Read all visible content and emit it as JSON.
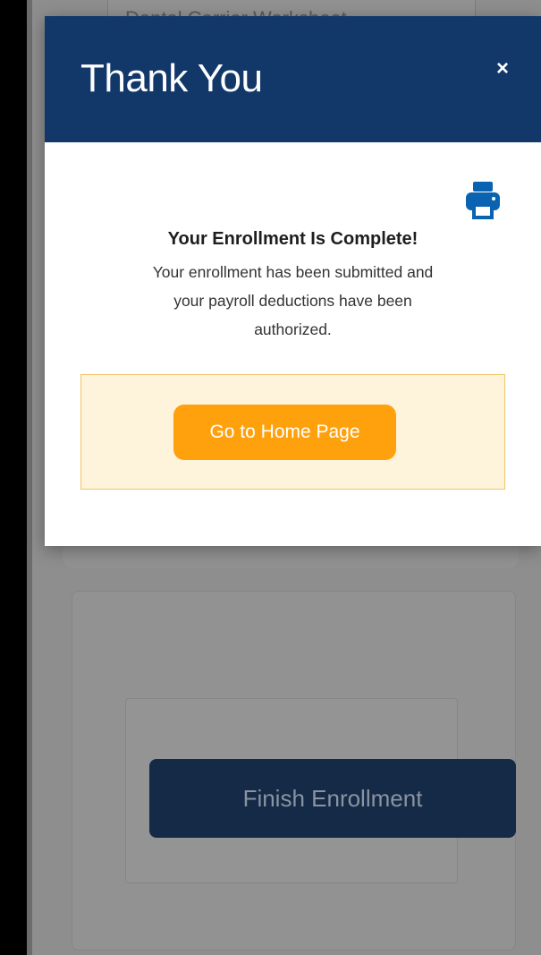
{
  "background": {
    "title_text": "Dental Carrier Worksheet",
    "finish_button_label": "Finish Enrollment"
  },
  "modal": {
    "title": "Thank You",
    "close_glyph": "×",
    "print_icon": "print-icon",
    "heading": "Your Enrollment Is Complete!",
    "message_line1": "Your enrollment has been submitted and",
    "message_line2": "your payroll deductions have been",
    "message_line3": "authorized.",
    "home_button_label": "Go to Home Page"
  },
  "colors": {
    "header": "#12386a",
    "primary_action": "#ffa10d",
    "panel_bg": "#fef4dc",
    "panel_border": "#f0c46a",
    "print_icon": "#0a63b0",
    "finish_button": "#142a47"
  }
}
